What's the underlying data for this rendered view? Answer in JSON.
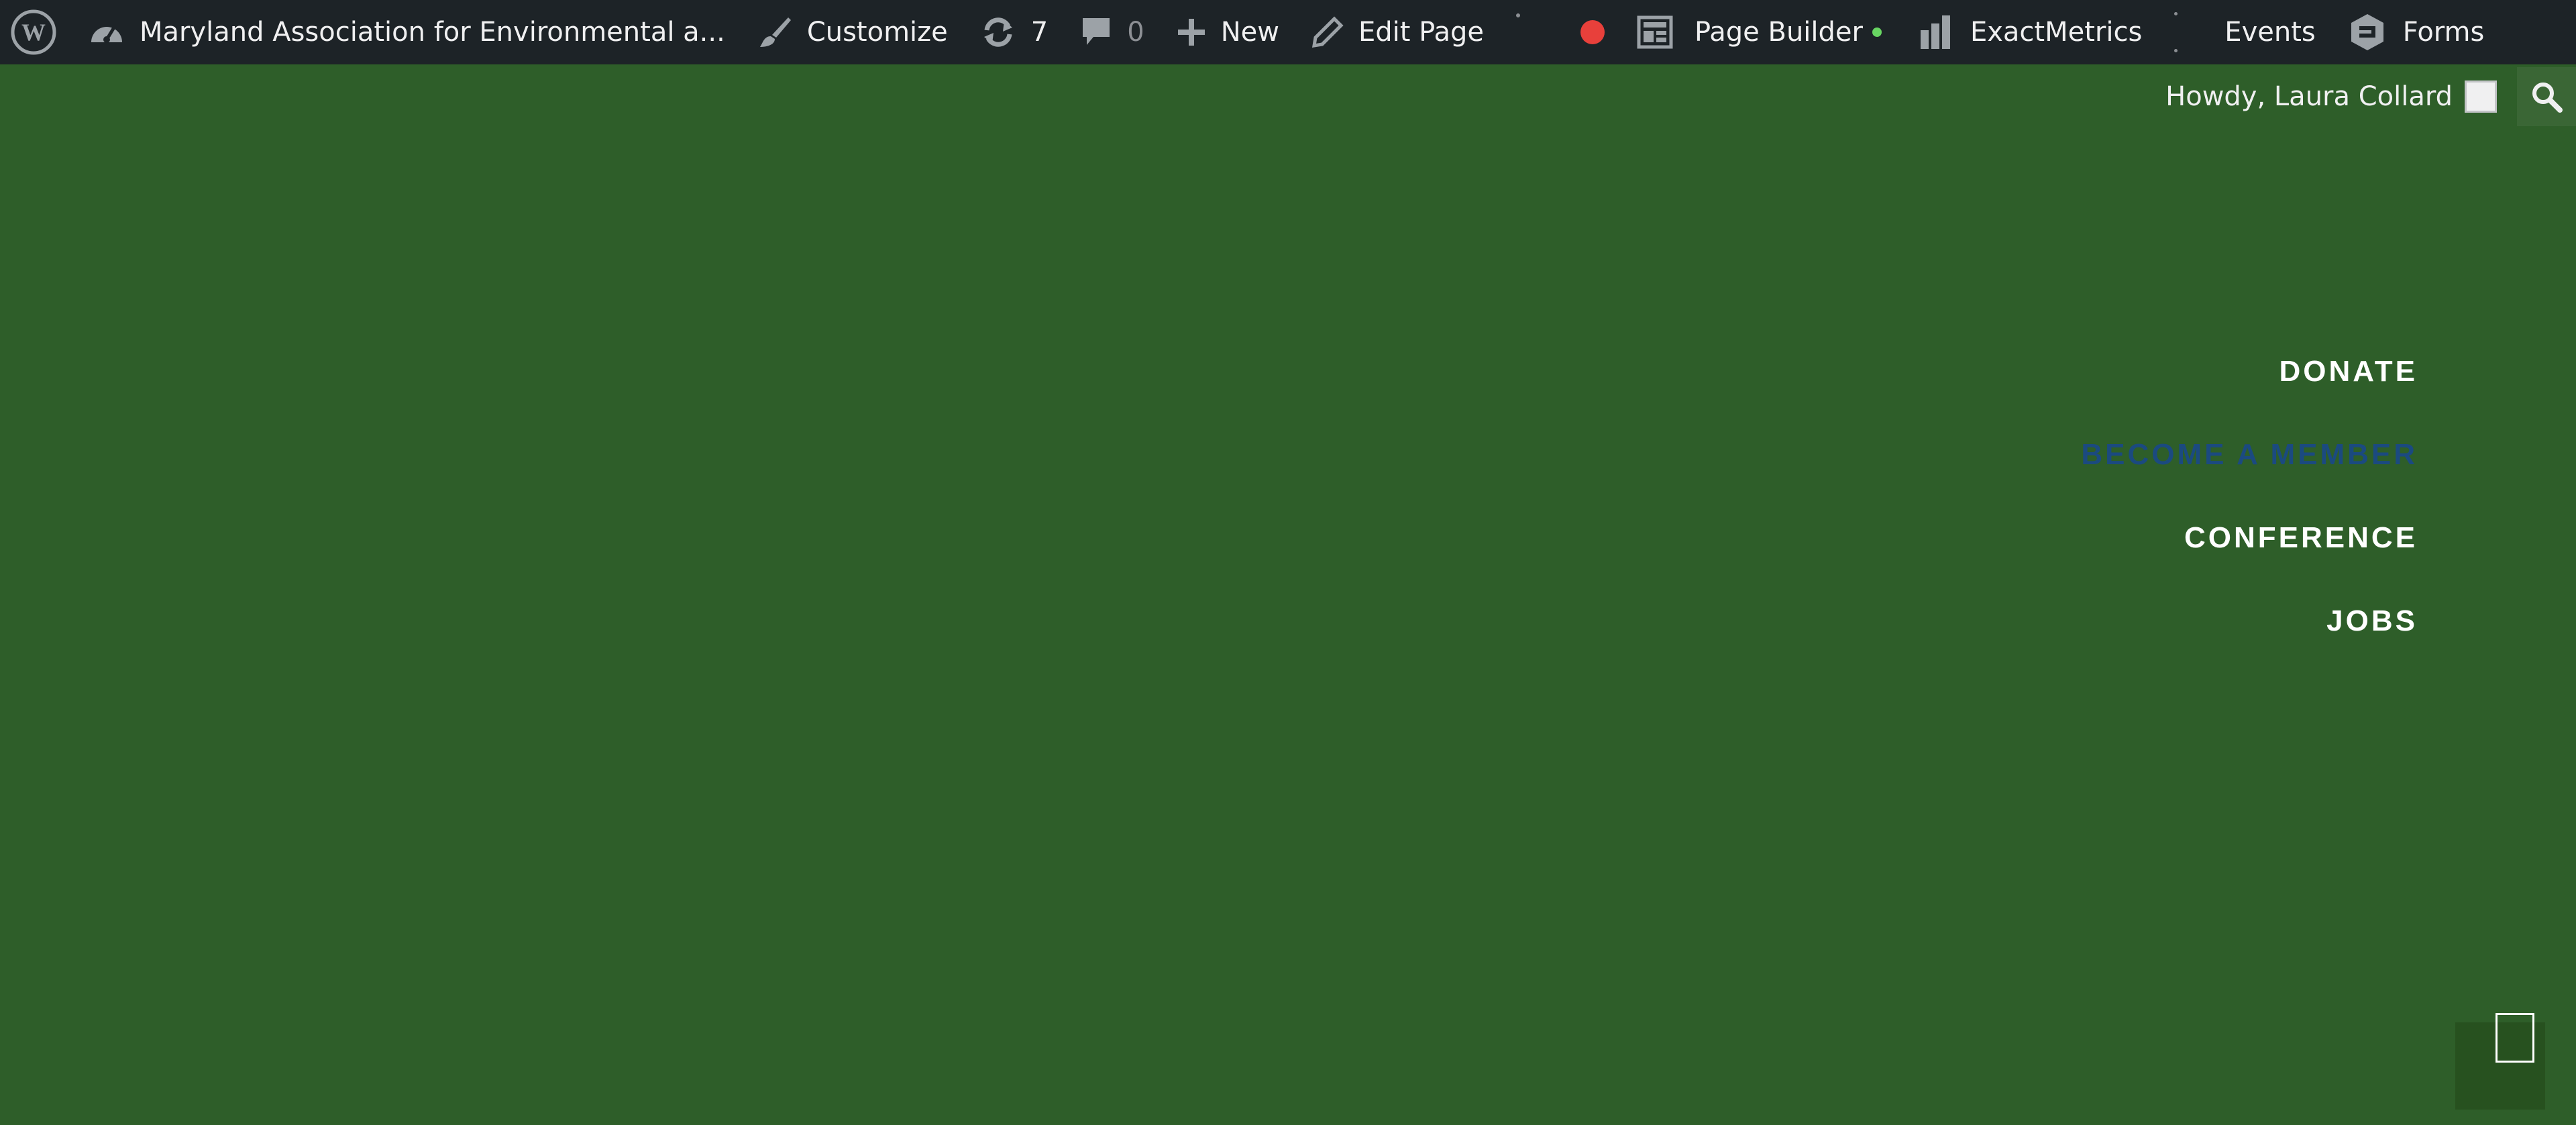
{
  "adminbar": {
    "site_name": "Maryland Association for Environmental a...",
    "customize": "Customize",
    "updates_count": "7",
    "comments_count": "0",
    "new": "New",
    "edit_page": "Edit Page",
    "page_builder": "Page Builder",
    "exactmetrics": "ExactMetrics",
    "events": "Events",
    "forms": "Forms",
    "recording_dot_color": "#e8403b",
    "page_builder_dot_color": "#68d562"
  },
  "secondary": {
    "howdy": "Howdy, Laura Collard"
  },
  "nav": {
    "items": [
      {
        "label": "DONATE"
      },
      {
        "label": "BECOME A MEMBER"
      },
      {
        "label": "CONFERENCE"
      },
      {
        "label": "JOBS"
      }
    ],
    "active_color": "#1b4a80"
  },
  "colors": {
    "background": "#2e5e29",
    "adminbar": "#1d2327"
  }
}
